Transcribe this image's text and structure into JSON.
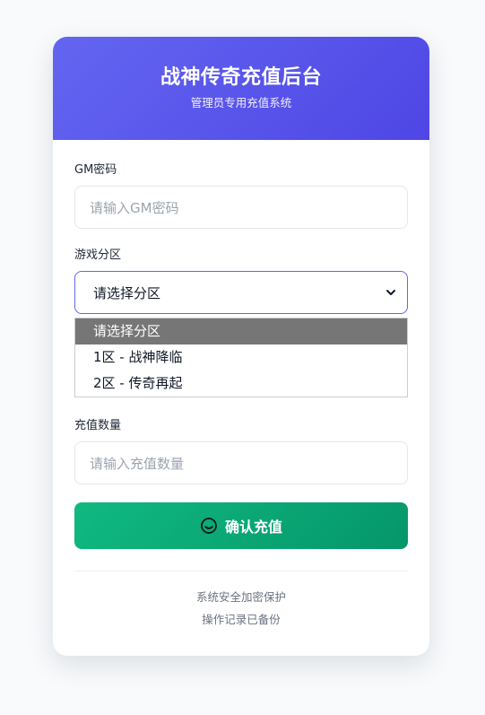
{
  "header": {
    "title": "战神传奇充值后台",
    "subtitle": "管理员专用充值系统"
  },
  "form": {
    "gm_password": {
      "label": "GM密码",
      "placeholder": "请输入GM密码"
    },
    "zone": {
      "label": "游戏分区",
      "selected": "请选择分区",
      "options": [
        "请选择分区",
        "1区 - 战神降临",
        "2区 - 传奇再起"
      ]
    },
    "amount": {
      "label": "充值数量",
      "placeholder": "请输入充值数量"
    },
    "submit_label": "确认充值"
  },
  "footer": {
    "line1": "系统安全加密保护",
    "line2": "操作记录已备份"
  },
  "colors": {
    "header_start": "#6366f1",
    "header_end": "#4f46e5",
    "button_start": "#10b981",
    "button_end": "#059669",
    "selected_option_bg": "#767676"
  },
  "icons": {
    "submit": "smile-circle-icon",
    "select_arrow": "chevron-down-icon"
  }
}
